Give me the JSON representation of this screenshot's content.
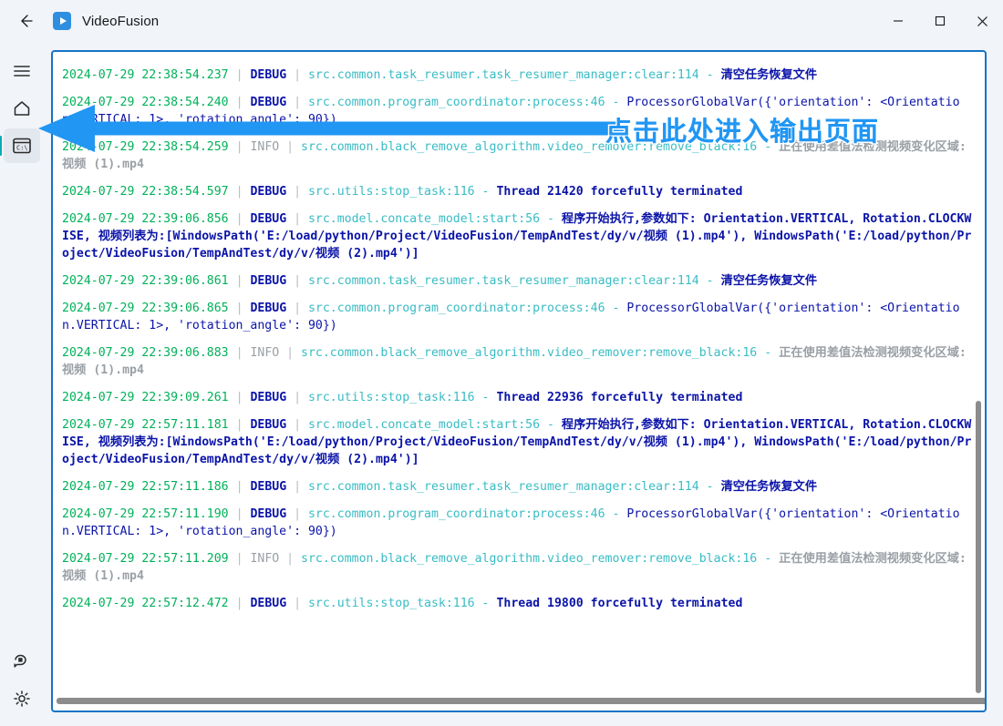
{
  "window": {
    "title": "VideoFusion",
    "back_label": "←",
    "minimize_label": "─",
    "maximize_label": "☐",
    "close_label": "✕",
    "app_icon": "video-play-icon"
  },
  "sidebar": {
    "top_items": [
      {
        "id": "menu",
        "icon": "hamburger-menu-icon",
        "selected": false
      },
      {
        "id": "home",
        "icon": "home-icon",
        "selected": false
      },
      {
        "id": "console",
        "icon": "terminal-console-icon",
        "selected": true
      }
    ],
    "bottom_items": [
      {
        "id": "feedback",
        "icon": "feedback-chat-icon",
        "selected": false
      },
      {
        "id": "settings",
        "icon": "gear-settings-icon",
        "selected": false
      }
    ]
  },
  "annotation": {
    "text": "点击此处进入输出页面",
    "arrow_color": "#2196f3",
    "text_color": "#2196f3",
    "outline_color": "#ffffff"
  },
  "colors": {
    "timestamp": "#00b159",
    "debug_level": "#0b14a8",
    "info_level": "#9aa0a6",
    "module": "#39bcc4",
    "message_blue": "#0b14a8",
    "message_gray": "#9aa0a6",
    "panel_border": "#1573c6",
    "accent_teal": "#09a9b4"
  },
  "log": {
    "lines": [
      {
        "timestamp": "2024-07-29 22:38:54.237",
        "level": "DEBUG",
        "level_style": "debug",
        "module": "src.common.task_resumer.task_resumer_manager:clear:114",
        "message": "清空任务恢复文件",
        "message_style": "blue"
      },
      {
        "timestamp": "2024-07-29 22:38:54.240",
        "level": "DEBUG",
        "level_style": "debug",
        "module": "src.common.program_coordinator:process:46",
        "message": "ProcessorGlobalVar({'orientation': <Orientation.VERTICAL: 1>, 'rotation_angle': 90})",
        "message_style": "plain"
      },
      {
        "timestamp": "2024-07-29 22:38:54.259",
        "level": "INFO",
        "level_style": "info",
        "module": "src.common.black_remove_algorithm.video_remover:remove_black:16",
        "message": "正在使用差值法检测视频变化区域: 视频 (1).mp4",
        "message_style": "gray"
      },
      {
        "timestamp": "2024-07-29 22:38:54.597",
        "level": "DEBUG",
        "level_style": "debug",
        "module": "src.utils:stop_task:116",
        "message": "Thread 21420 forcefully terminated",
        "message_style": "blue"
      },
      {
        "timestamp": "2024-07-29 22:39:06.856",
        "level": "DEBUG",
        "level_style": "debug",
        "module": "src.model.concate_model:start:56",
        "message": "程序开始执行,参数如下: Orientation.VERTICAL, Rotation.CLOCKWISE, 视频列表为:[WindowsPath('E:/load/python/Project/VideoFusion/TempAndTest/dy/v/视频 (1).mp4'), WindowsPath('E:/load/python/Project/VideoFusion/TempAndTest/dy/v/视频 (2).mp4')]",
        "message_style": "blue"
      },
      {
        "timestamp": "2024-07-29 22:39:06.861",
        "level": "DEBUG",
        "level_style": "debug",
        "module": "src.common.task_resumer.task_resumer_manager:clear:114",
        "message": "清空任务恢复文件",
        "message_style": "blue"
      },
      {
        "timestamp": "2024-07-29 22:39:06.865",
        "level": "DEBUG",
        "level_style": "debug",
        "module": "src.common.program_coordinator:process:46",
        "message": "ProcessorGlobalVar({'orientation': <Orientation.VERTICAL: 1>, 'rotation_angle': 90})",
        "message_style": "plain"
      },
      {
        "timestamp": "2024-07-29 22:39:06.883",
        "level": "INFO",
        "level_style": "info",
        "module": "src.common.black_remove_algorithm.video_remover:remove_black:16",
        "message": "正在使用差值法检测视频变化区域: 视频 (1).mp4",
        "message_style": "gray"
      },
      {
        "timestamp": "2024-07-29 22:39:09.261",
        "level": "DEBUG",
        "level_style": "debug",
        "module": "src.utils:stop_task:116",
        "message": "Thread 22936 forcefully terminated",
        "message_style": "blue"
      },
      {
        "timestamp": "2024-07-29 22:57:11.181",
        "level": "DEBUG",
        "level_style": "debug",
        "module": "src.model.concate_model:start:56",
        "message": "程序开始执行,参数如下: Orientation.VERTICAL, Rotation.CLOCKWISE, 视频列表为:[WindowsPath('E:/load/python/Project/VideoFusion/TempAndTest/dy/v/视频 (1).mp4'), WindowsPath('E:/load/python/Project/VideoFusion/TempAndTest/dy/v/视频 (2).mp4')]",
        "message_style": "blue"
      },
      {
        "timestamp": "2024-07-29 22:57:11.186",
        "level": "DEBUG",
        "level_style": "debug",
        "module": "src.common.task_resumer.task_resumer_manager:clear:114",
        "message": "清空任务恢复文件",
        "message_style": "blue"
      },
      {
        "timestamp": "2024-07-29 22:57:11.190",
        "level": "DEBUG",
        "level_style": "debug",
        "module": "src.common.program_coordinator:process:46",
        "message": "ProcessorGlobalVar({'orientation': <Orientation.VERTICAL: 1>, 'rotation_angle': 90})",
        "message_style": "plain"
      },
      {
        "timestamp": "2024-07-29 22:57:11.209",
        "level": "INFO",
        "level_style": "info",
        "module": "src.common.black_remove_algorithm.video_remover:remove_black:16",
        "message": "正在使用差值法检测视频变化区域: 视频 (1).mp4",
        "message_style": "gray"
      },
      {
        "timestamp": "2024-07-29 22:57:12.472",
        "level": "DEBUG",
        "level_style": "debug",
        "module": "src.utils:stop_task:116",
        "message": "Thread 19800 forcefully terminated",
        "message_style": "blue"
      }
    ]
  }
}
